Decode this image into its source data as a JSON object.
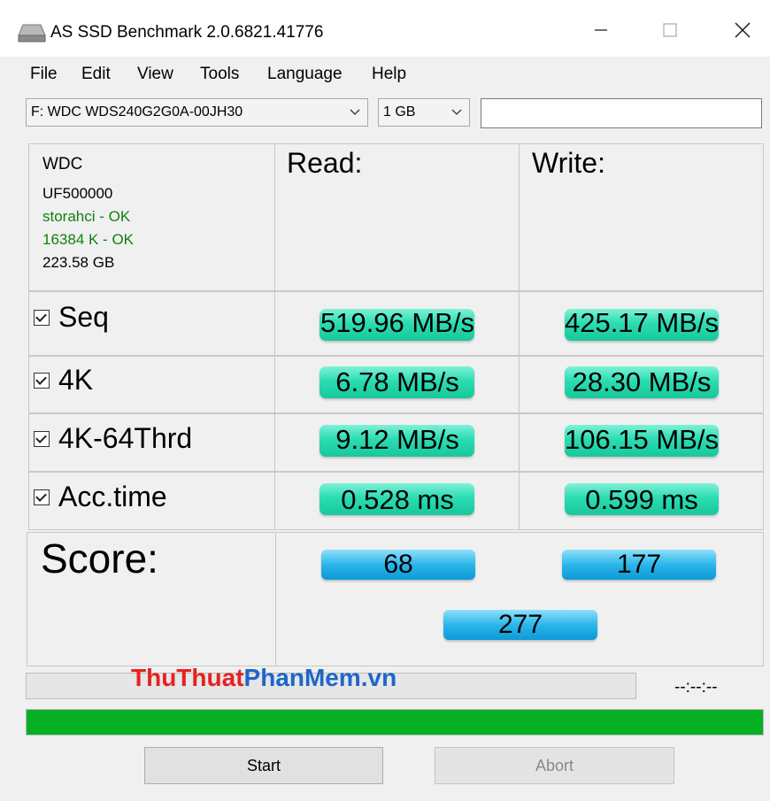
{
  "window": {
    "title": "AS SSD Benchmark 2.0.6821.41776"
  },
  "menu": [
    "File",
    "Edit",
    "View",
    "Tools",
    "Language",
    "Help"
  ],
  "toolbar": {
    "drive": "F: WDC WDS240G2G0A-00JH30",
    "size": "1 GB",
    "search_value": ""
  },
  "drive_info": {
    "vendor": "WDC",
    "firmware": "UF500000",
    "driver": "storahci - OK",
    "alignment": "16384 K - OK",
    "capacity": "223.58 GB"
  },
  "headers": {
    "read": "Read:",
    "write": "Write:"
  },
  "rows": [
    {
      "label": "Seq",
      "checked": true,
      "read": "519.96 MB/s",
      "write": "425.17 MB/s"
    },
    {
      "label": "4K",
      "checked": true,
      "read": "6.78 MB/s",
      "write": "28.30 MB/s"
    },
    {
      "label": "4K-64Thrd",
      "checked": true,
      "read": "9.12 MB/s",
      "write": "106.15 MB/s"
    },
    {
      "label": "Acc.time",
      "checked": true,
      "read": "0.528 ms",
      "write": "0.599 ms"
    }
  ],
  "score": {
    "label": "Score:",
    "read": "68",
    "write": "177",
    "total": "277"
  },
  "status": {
    "timer": "--:--:--",
    "watermark_a": "ThuThuat",
    "watermark_b": "PhanMem",
    "watermark_c": ".vn",
    "progress": 1.0
  },
  "buttons": {
    "start": "Start",
    "abort": "Abort"
  },
  "colors": {
    "result_bar": "#2bdcb2",
    "score_bar": "#2bb6ea",
    "progress": "#06b025",
    "ok_text": "#108010"
  }
}
